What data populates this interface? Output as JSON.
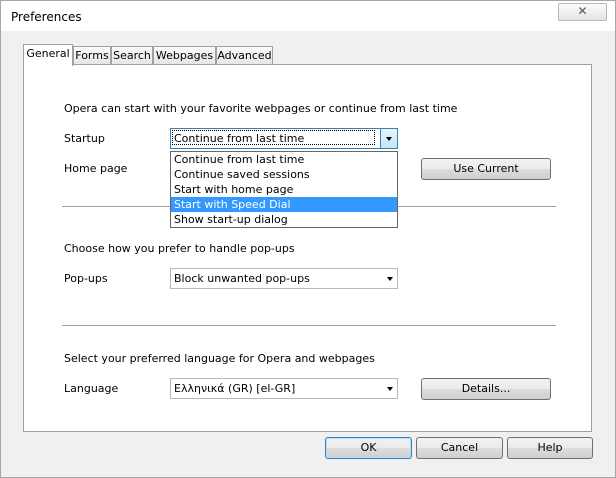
{
  "window": {
    "title": "Preferences",
    "close_label": "✕"
  },
  "tabs": [
    {
      "label": "General"
    },
    {
      "label": "Forms"
    },
    {
      "label": "Search"
    },
    {
      "label": "Webpages"
    },
    {
      "label": "Advanced"
    }
  ],
  "startup_section": {
    "heading": "Opera can start with your favorite webpages or continue from last time",
    "startup_label": "Startup",
    "startup_value": "Continue from last time",
    "home_label": "Home page",
    "use_current_label": "Use Current",
    "options": [
      "Continue from last time",
      "Continue saved sessions",
      "Start with home page",
      "Start with Speed Dial",
      "Show start-up dialog"
    ],
    "highlighted_option": "Start with Speed Dial"
  },
  "popups_section": {
    "heading": "Choose how you prefer to handle pop-ups",
    "label": "Pop-ups",
    "value": "Block unwanted pop-ups"
  },
  "language_section": {
    "heading": "Select your preferred language for Opera and webpages",
    "label": "Language",
    "value": "Ελληνικά (GR) [el-GR]",
    "details_label": "Details..."
  },
  "footer": {
    "ok": "OK",
    "cancel": "Cancel",
    "help": "Help"
  }
}
